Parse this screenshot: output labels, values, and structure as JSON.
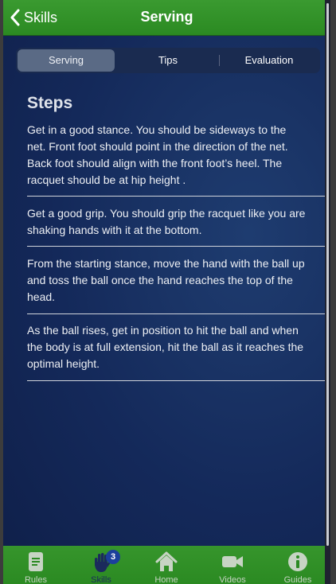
{
  "nav": {
    "back_label": "Skills",
    "title": "Serving"
  },
  "segments": [
    {
      "label": "Serving",
      "active": true
    },
    {
      "label": "Tips",
      "active": false
    },
    {
      "label": "Evaluation",
      "active": false
    }
  ],
  "content": {
    "heading": "Steps",
    "steps": [
      "Get in a good stance. You should be sideways to the net. Front foot should point in the direction of the net. Back foot should align with the front foot’s heel. The racquet should be at hip height .",
      "Get a good grip. You should grip the racquet like you are shaking hands with it at the bottom.",
      "From the starting stance, move the hand with the ball up and toss the ball once the hand reaches the top of the head.",
      "As the ball rises, get in position to hit the ball and when the body is at full extension, hit the ball as it reaches the optimal height."
    ]
  },
  "tabbar": {
    "tabs": [
      {
        "label": "Rules",
        "icon": "document-icon"
      },
      {
        "label": "Skills",
        "icon": "hand-icon",
        "badge": "3",
        "active": true
      },
      {
        "label": "Home",
        "icon": "home-icon"
      },
      {
        "label": "Videos",
        "icon": "video-camera-icon"
      },
      {
        "label": "Guides",
        "icon": "info-icon"
      }
    ]
  },
  "colors": {
    "nav_green": "#2b8a22",
    "background_navy": "#14295a",
    "active_tab": "#1b2a5c",
    "badge": "#1c3f9c"
  }
}
